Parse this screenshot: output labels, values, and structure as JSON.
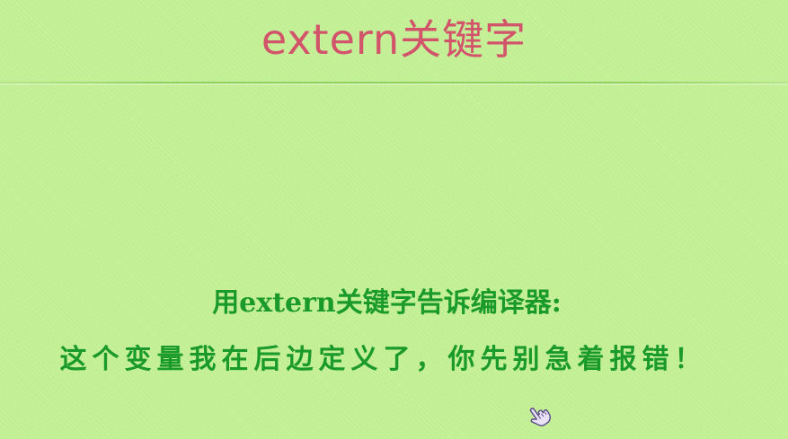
{
  "slide": {
    "title": "extern关键字",
    "line1": "用extern关键字告诉编译器:",
    "line2": "这个变量我在后边定义了，你先别急着报错！"
  },
  "colors": {
    "background": "#c3ef94",
    "title": "#d1546b",
    "body_text": "#1a9a2a",
    "divider": "#8fd060"
  },
  "icons": {
    "cursor": "hand-pointer-icon"
  }
}
